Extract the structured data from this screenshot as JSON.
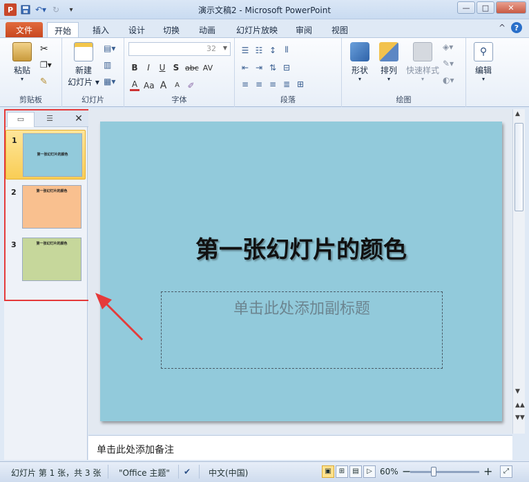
{
  "window": {
    "title": "演示文稿2 - Microsoft PowerPoint",
    "controls": [
      "—",
      "□",
      "✕"
    ]
  },
  "tabs": [
    {
      "label": "文件"
    },
    {
      "label": "开始"
    },
    {
      "label": "插入"
    },
    {
      "label": "设计"
    },
    {
      "label": "切换"
    },
    {
      "label": "动画"
    },
    {
      "label": "幻灯片放映"
    },
    {
      "label": "审阅"
    },
    {
      "label": "视图"
    }
  ],
  "help": {
    "collapse": "^",
    "help": "?"
  },
  "ribbon": {
    "groups": {
      "clipboard": {
        "label": "剪贴板",
        "paste": "粘贴"
      },
      "slides": {
        "label": "幻灯片",
        "new_slide_line1": "新建",
        "new_slide_line2": "幻灯片 ▾"
      },
      "font": {
        "label": "字体",
        "font_size": "32",
        "b": "B",
        "i": "I",
        "u": "U",
        "s": "S",
        "abc": "abc",
        "av": "AV",
        "a": "A",
        "aa": "Aa",
        "grow": "A",
        "shrink": "A"
      },
      "paragraph": {
        "label": "段落"
      },
      "drawing": {
        "label": "绘图",
        "shapes": "形状",
        "arrange": "排列",
        "quick_styles": "快速样式"
      },
      "editing": {
        "label": "编辑",
        "edit": "编辑"
      }
    }
  },
  "panel": {
    "tab_slides_icon": "slides-icon",
    "tab_outline_icon": "outline-icon",
    "close": "✕",
    "slides": [
      {
        "num": "1",
        "title": "第一张幻灯片的颜色",
        "color": "#92cadb"
      },
      {
        "num": "2",
        "title": "第一张幻灯片的颜色",
        "color": "#f9c08f"
      },
      {
        "num": "3",
        "title": "第一张幻灯片的颜色",
        "color": "#c6d79b"
      }
    ]
  },
  "slide": {
    "title": "第一张幻灯片的颜色",
    "subtitle_placeholder": "单击此处添加副标题",
    "background": "#92cadb"
  },
  "notes": {
    "placeholder": "单击此处添加备注"
  },
  "status": {
    "slide_info": "幻灯片 第 1 张，共 3 张",
    "theme": "\"Office 主题\"",
    "language": "中文(中国)",
    "zoom": "60%",
    "zoom_minus": "−",
    "zoom_plus": "+"
  },
  "colors": {
    "accent": "#e53a3a",
    "file_tab": "#c8471f"
  }
}
